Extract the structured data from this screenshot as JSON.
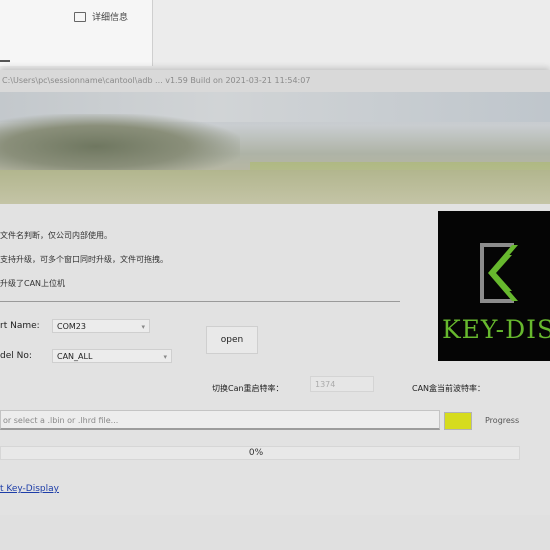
{
  "background_window": {
    "detail_label": "详细信息"
  },
  "window": {
    "title": "C:\\Users\\pc\\sessionname\\cantool\\adb ... v1.59  Build on 2021-03-21 11:54:07"
  },
  "notes": [
    "文件名判断，仅公司内部使用。",
    "支持升级，可多个窗口同时升级，文件可拖拽。",
    "升级了CAN上位机"
  ],
  "form": {
    "port_label": "rt Name:",
    "port_value": "COM23",
    "model_label": "del No:",
    "model_value": "CAN_ALL",
    "open_button": "open",
    "switch_baud_label": "切换Can重启特率：",
    "switch_baud_value": "1374",
    "can_baud_label": "CAN盒当前波特率：",
    "file_placeholder": "or select a .lbin or .lhrd file...",
    "progress_label": "Progress",
    "progress_value": 0,
    "progress_text": "0%",
    "about_link": "t Key-Display"
  },
  "logo": {
    "text": "KEY-DISP"
  },
  "colors": {
    "accent_green": "#d6dc1d",
    "logo_green": "#67b82e",
    "logo_background": "#050505",
    "link_blue": "#1d3da8"
  },
  "icons": {
    "detail": "detail-icon",
    "dropdown": "chevron-down-icon"
  }
}
